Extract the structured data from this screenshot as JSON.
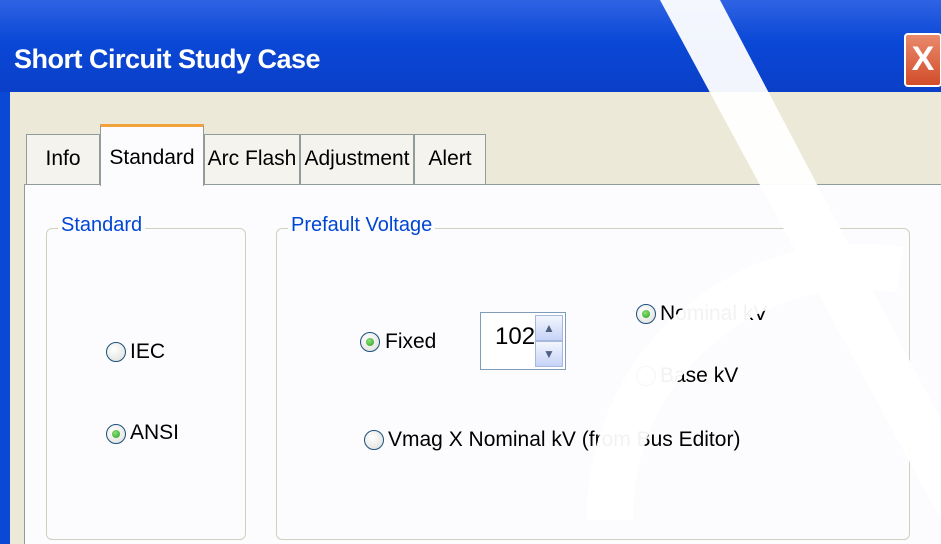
{
  "window": {
    "title": "Short Circuit Study Case",
    "close_label": "X"
  },
  "tabs": [
    {
      "label": "Info",
      "active": false
    },
    {
      "label": "Standard",
      "active": true
    },
    {
      "label": "Arc Flash",
      "active": false
    },
    {
      "label": "Adjustment",
      "active": false
    },
    {
      "label": "Alert",
      "active": false
    }
  ],
  "standard_group": {
    "title": "Standard",
    "options": [
      {
        "label": "IEC",
        "checked": false
      },
      {
        "label": "ANSI",
        "checked": true
      }
    ]
  },
  "prefault_group": {
    "title": "Prefault Voltage",
    "fixed_label": "Fixed",
    "fixed_checked": true,
    "fixed_value": "102",
    "nominal_label": "Nominal kV",
    "nominal_checked": true,
    "base_label": "Base kV",
    "base_checked": false,
    "vmag_label": "Vmag X Nominal kV (from Bus Editor)",
    "vmag_checked": false
  },
  "icons": {
    "spin_up": "up-arrow-icon",
    "spin_down": "down-arrow-icon"
  },
  "colors": {
    "titlebar": "#0a48d6",
    "group_title": "#0046d5",
    "active_tab_accent": "#f2a23a",
    "radio_dot": "#21a121"
  }
}
